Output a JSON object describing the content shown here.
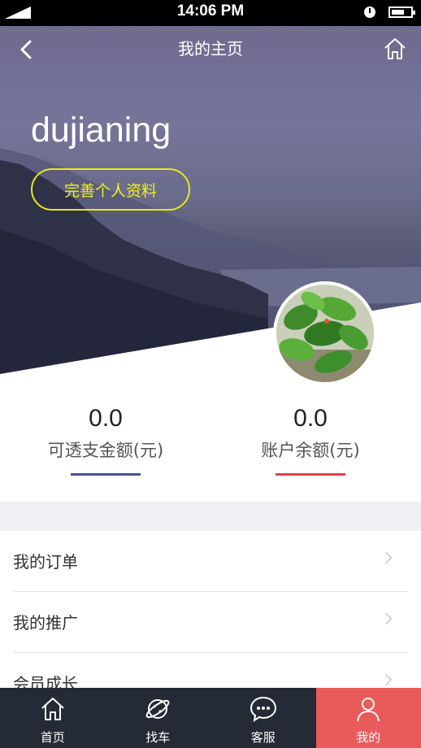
{
  "status_bar": {
    "time": "14:06 PM"
  },
  "header": {
    "title": "我的主页"
  },
  "profile": {
    "username": "dujianing",
    "edit_button": "完善个人资料"
  },
  "stats": [
    {
      "value": "0.0",
      "label": "可透支金额(元)",
      "accent": "#4a4f96"
    },
    {
      "value": "0.0",
      "label": "账户余额(元)",
      "accent": "#e0424e"
    }
  ],
  "menu": [
    {
      "label": "我的订单"
    },
    {
      "label": "我的推广"
    },
    {
      "label": "会员成长"
    }
  ],
  "tabbar": [
    {
      "label": "首页",
      "icon": "home-icon"
    },
    {
      "label": "找车",
      "icon": "planet-icon"
    },
    {
      "label": "客服",
      "icon": "chat-icon"
    },
    {
      "label": "我的",
      "icon": "user-icon",
      "active": true
    }
  ],
  "colors": {
    "tab_active": "#e95a5a",
    "tabbar_bg": "#242a36",
    "edit_button": "#f0f01c"
  }
}
